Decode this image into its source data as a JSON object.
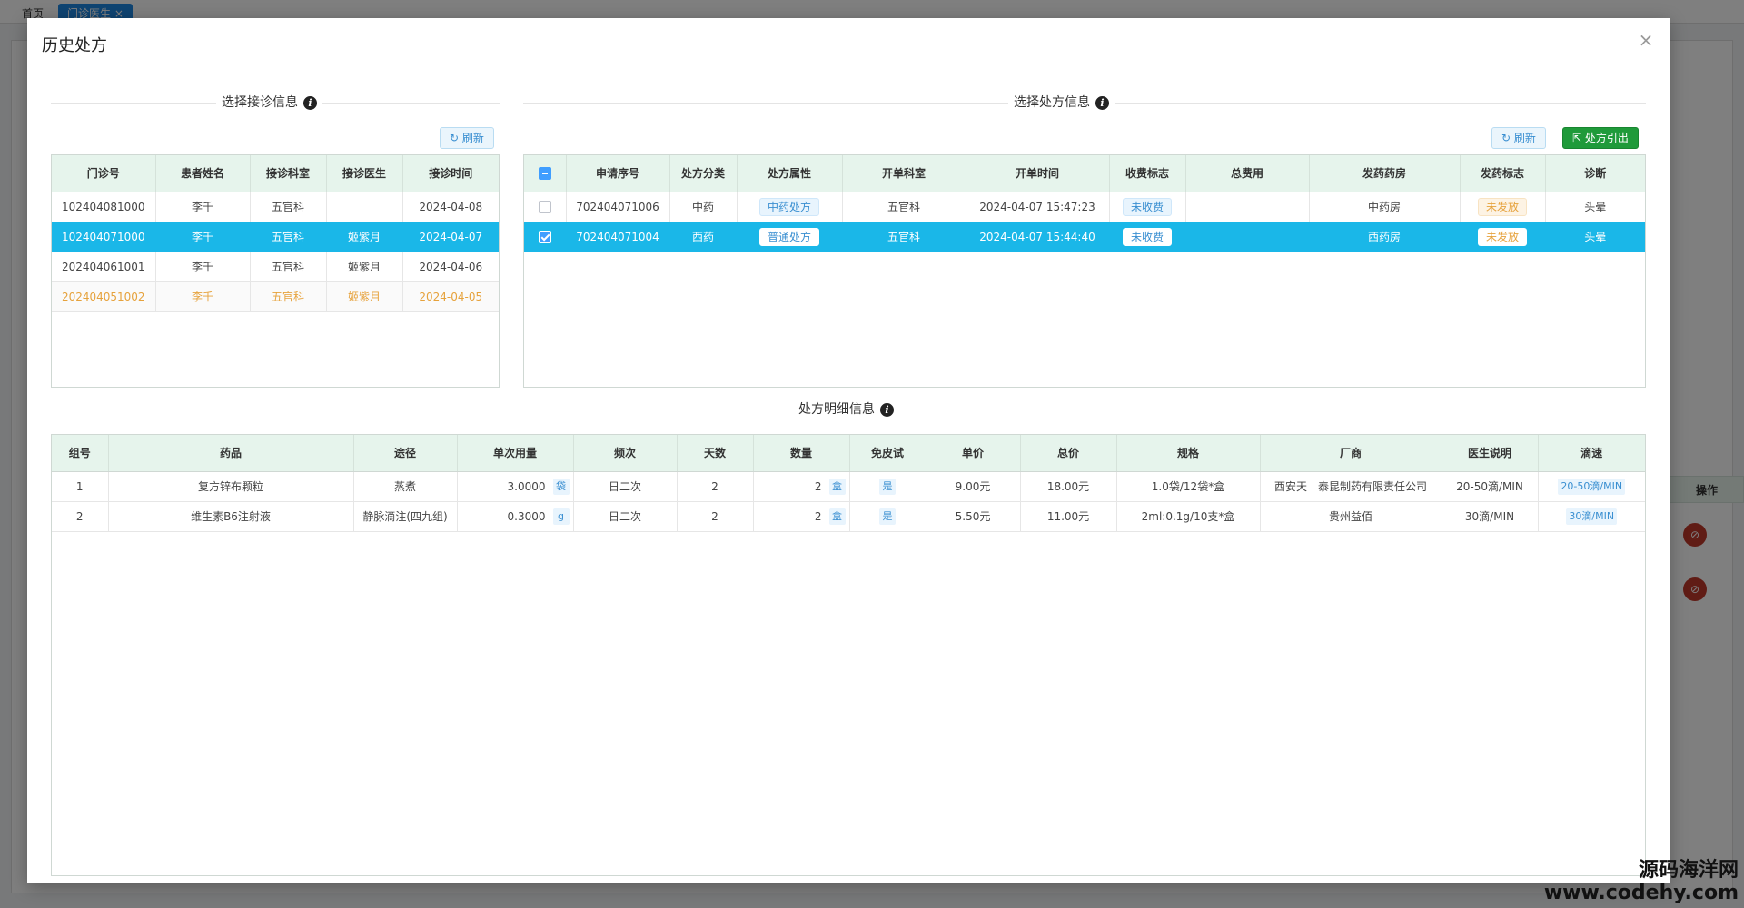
{
  "background": {
    "tabs": [
      {
        "label": "首页"
      },
      {
        "label": "门诊医生 ×"
      }
    ],
    "ops_header": "操作",
    "op_icon": "⊘"
  },
  "modal": {
    "title": "历史处方",
    "close_icon": "×"
  },
  "visit_section": {
    "title": "选择接诊信息",
    "refresh_label": "刷新",
    "columns": [
      "门诊号",
      "患者姓名",
      "接诊科室",
      "接诊医生",
      "接诊时间"
    ],
    "rows": [
      {
        "no": "102404081000",
        "patient": "李千",
        "dept": "五官科",
        "doctor": "",
        "time": "2024-04-08"
      },
      {
        "no": "102404071000",
        "patient": "李千",
        "dept": "五官科",
        "doctor": "姬紫月",
        "time": "2024-04-07"
      },
      {
        "no": "202404061001",
        "patient": "李千",
        "dept": "五官科",
        "doctor": "姬紫月",
        "time": "2024-04-06"
      },
      {
        "no": "202404051002",
        "patient": "李千",
        "dept": "五官科",
        "doctor": "姬紫月",
        "time": "2024-04-05"
      }
    ]
  },
  "prescription_section": {
    "title": "选择处方信息",
    "refresh_label": "刷新",
    "cite_label": "处方引出",
    "columns": [
      "申请序号",
      "处方分类",
      "处方属性",
      "开单科室",
      "开单时间",
      "收费标志",
      "总费用",
      "发药药房",
      "发药标志",
      "诊断"
    ],
    "rows": [
      {
        "seq": "702404071006",
        "category": "中药",
        "attr": "中药处方",
        "dept": "五官科",
        "time": "2024-04-07 15:47:23",
        "charge": "未收费",
        "total": "",
        "pharmacy": "中药房",
        "dispense": "未发放",
        "diagnosis": "头晕"
      },
      {
        "seq": "702404071004",
        "category": "西药",
        "attr": "普通处方",
        "dept": "五官科",
        "time": "2024-04-07 15:44:40",
        "charge": "未收费",
        "total": "",
        "pharmacy": "西药房",
        "dispense": "未发放",
        "diagnosis": "头晕"
      }
    ]
  },
  "detail_section": {
    "title": "处方明细信息",
    "columns": [
      "组号",
      "药品",
      "途径",
      "单次用量",
      "频次",
      "天数",
      "数量",
      "免皮试",
      "单价",
      "总价",
      "规格",
      "厂商",
      "医生说明",
      "滴速"
    ],
    "rows": [
      {
        "group": "1",
        "drug": "复方锌布颗粒",
        "route": "蒸煮",
        "dose": "3.0000",
        "dose_unit": "袋",
        "freq": "日二次",
        "days": "2",
        "qty": "2",
        "qty_unit": "盒",
        "skin": "是",
        "price": "9.00元",
        "total": "18.00元",
        "spec": "1.0袋/12袋*盒",
        "maker": "西安天　泰昆制药有限责任公司",
        "note": "20-50滴/MIN",
        "drip": "20-50滴/MIN"
      },
      {
        "group": "2",
        "drug": "维生素B6注射液",
        "route": "静脉滴注(四九组)",
        "dose": "0.3000",
        "dose_unit": "g",
        "freq": "日二次",
        "days": "2",
        "qty": "2",
        "qty_unit": "盒",
        "skin": "是",
        "price": "5.50元",
        "total": "11.00元",
        "spec": "2ml:0.1g/10支*盒",
        "maker": "贵州益佰",
        "note": "30滴/MIN",
        "drip": "30滴/MIN"
      }
    ]
  },
  "watermark": {
    "cn": "源码海洋网",
    "url": "www.codehy.com"
  }
}
